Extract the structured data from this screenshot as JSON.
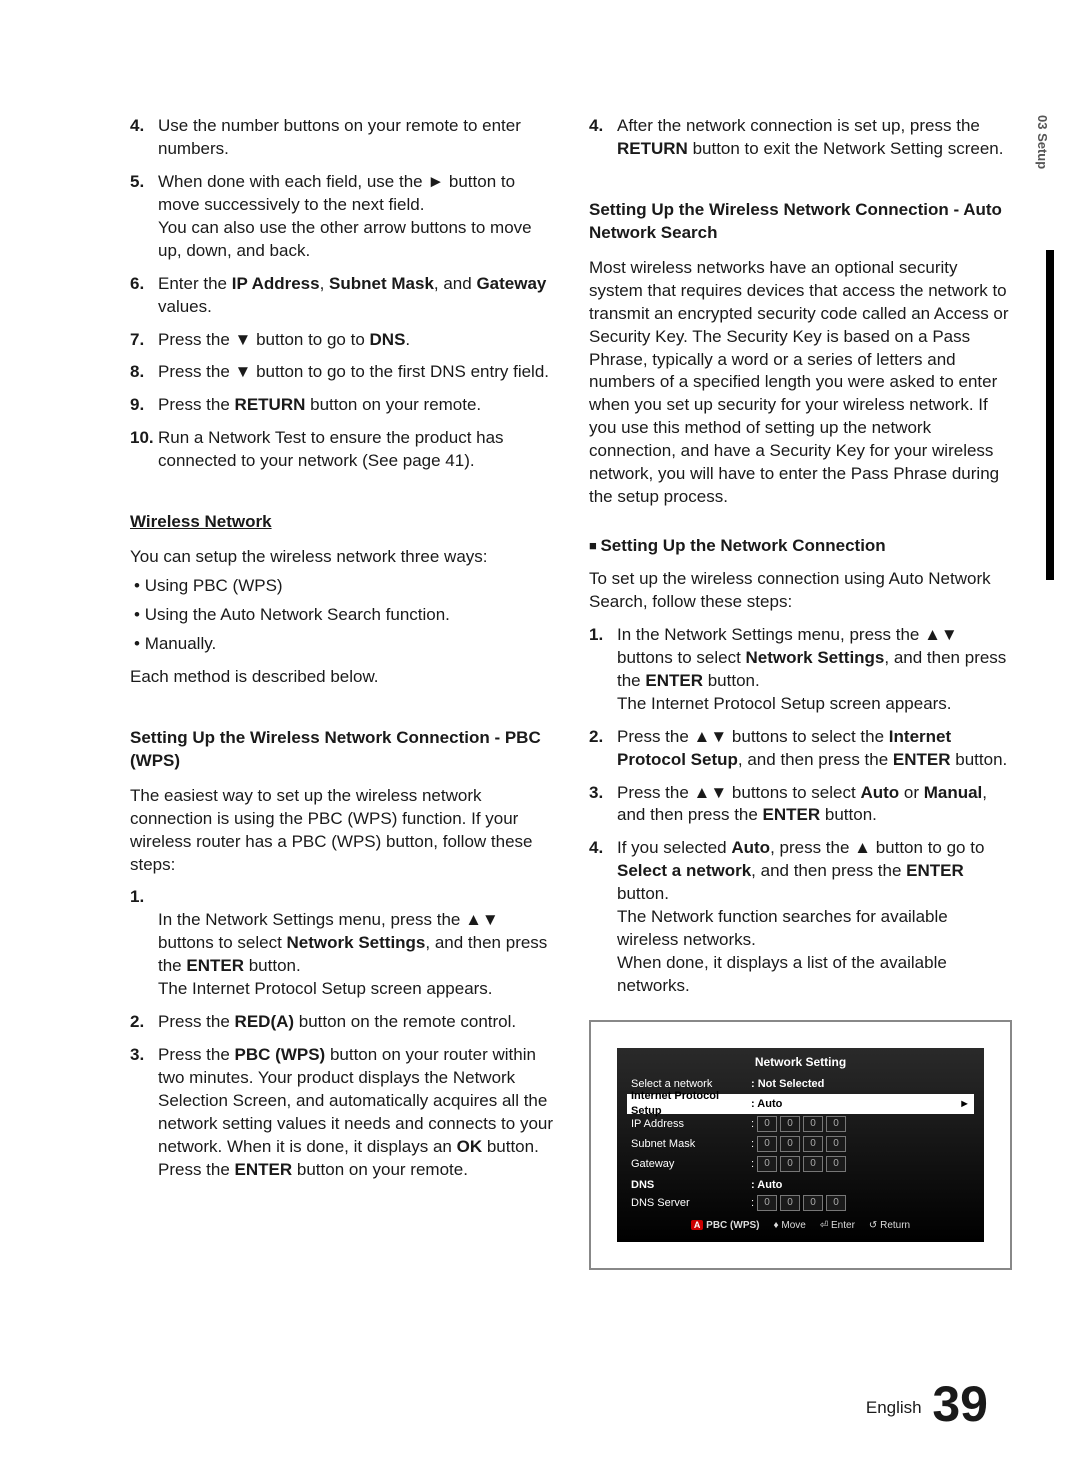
{
  "side_tab": "03   Setup",
  "left": {
    "list1": [
      {
        "n": "4.",
        "t": "Use the number buttons on your remote to enter numbers."
      },
      {
        "n": "5.",
        "t_before": "When done with each field, use the ",
        "t_after": " button to move successively to the next field.\nYou can also use the other arrow buttons to move up, down, and back.",
        "arrow": "►"
      },
      {
        "n": "6.",
        "t_before": "Enter the ",
        "b1": "IP Address",
        "t_mid1": ", ",
        "b2": "Subnet Mask",
        "t_mid2": ", and ",
        "b3": "Gateway",
        "t_after": " values."
      },
      {
        "n": "7.",
        "t_before": "Press the ▼ button to go to ",
        "b1": "DNS",
        "t_after": "."
      },
      {
        "n": "8.",
        "t": "Press the ▼ button to go to the first DNS entry field."
      },
      {
        "n": "9.",
        "t_before": "Press the ",
        "b1": "RETURN",
        "t_after": " button on your remote."
      },
      {
        "n": "10.",
        "t": "Run a Network Test to ensure the product has connected to your network (See page 41)."
      }
    ],
    "wireless_header": "Wireless Network",
    "wireless_intro": "You can setup the wireless network three ways:",
    "wireless_bullets": [
      "Using PBC (WPS)",
      "Using the Auto Network Search function.",
      "Manually."
    ],
    "wireless_outro": "Each method is described below.",
    "pbct_header": "Setting Up the Wireless Network Connection - PBC (WPS)",
    "pbct_intro": "The easiest way to set up the wireless network connection is using the PBC (WPS) function. If your wireless router has a PBC (WPS) button, follow these steps:",
    "pbclist": [
      {
        "n": "1.",
        "t_before": "In the Network Settings menu, press the ▲▼ buttons to select ",
        "b1": "Network Settings",
        "t_mid1": ", and then press the ",
        "b2": "ENTER",
        "t_after": " button.\nThe Internet Protocol Setup screen appears."
      },
      {
        "n": "2.",
        "t_before": "Press the ",
        "b1": "RED(A)",
        "t_after": " button on the remote control."
      },
      {
        "n": "3.",
        "t_before": "Press the ",
        "b1": "PBC (WPS)",
        "t_mid1": " button on your router within two minutes. Your product displays the Network Selection Screen, and automatically acquires all the network setting values it needs and connects to your network. When it is done, it displays an ",
        "b2": "OK",
        "t_mid2": " button. Press the ",
        "b3": "ENTER",
        "t_after": " button on your remote."
      }
    ]
  },
  "right": {
    "top4": {
      "n": "4.",
      "t_before": "After the network connection is set up, press the ",
      "b1": "RETURN",
      "t_after": " button to exit the Network Setting screen."
    },
    "auto_header": "Setting Up the Wireless Network Connection - Auto Network Search",
    "auto_para": "Most wireless networks have an optional security system that requires devices that access the network to transmit an encrypted security code called an Access or Security Key. The Security Key is based on a Pass Phrase, typically a word or a series of letters and numbers of a specified length you were asked to enter when you set up security for your wireless network. If you use this method of setting up the network connection, and have a Security Key for your wireless network, you will have to enter the Pass Phrase during the setup process.",
    "sub_header": "Setting Up the Network Connection",
    "sub_intro": "To set up the wireless connection using Auto Network Search, follow these steps:",
    "autolist": [
      {
        "n": "1.",
        "t_before": "In the Network Settings menu, press the ▲▼ buttons to select ",
        "b1": "Network Settings",
        "t_mid1": ", and then press the ",
        "b2": "ENTER",
        "t_after": " button.\nThe Internet Protocol Setup screen appears."
      },
      {
        "n": "2.",
        "t_before": "Press the ▲▼ buttons to select the ",
        "b1": "Internet Protocol Setup",
        "t_mid1": ", and then press the ",
        "b2": "ENTER",
        "t_after": " button."
      },
      {
        "n": "3.",
        "t_before": "Press the ▲▼ buttons to select ",
        "b1": "Auto",
        "t_mid1": " or ",
        "b2": "Manual",
        "t_mid2": ", and then press the ",
        "b3": "ENTER",
        "t_after": " button."
      },
      {
        "n": "4.",
        "t_before": "If you selected ",
        "b1": "Auto",
        "t_mid1": ", press the ▲ button to go to ",
        "b2": "Select a network",
        "t_mid2": ", and then press the ",
        "b3": "ENTER",
        "t_after": " button.\nThe Network function searches for available wireless networks.\nWhen done, it displays a list of the available networks."
      }
    ]
  },
  "screen": {
    "title": "Network Setting",
    "rows": {
      "select_label": "Select a network",
      "select_value": ": Not Selected",
      "ips_label": "Internet Protocol Setup",
      "ips_value": ": Auto",
      "ip_label": "IP Address",
      "subnet_label": "Subnet Mask",
      "gateway_label": "Gateway",
      "dns_label": "DNS",
      "dns_value": ": Auto",
      "dnsserver_label": "DNS Server",
      "octet": "0"
    },
    "footer": {
      "a": "A",
      "pbct": "PBC (WPS)",
      "move": "Move",
      "enter": "Enter",
      "return": "Return"
    }
  },
  "footer_lang": "English",
  "footer_page": "39"
}
